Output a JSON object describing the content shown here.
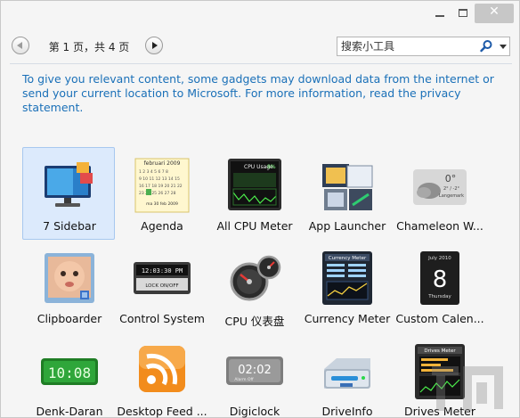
{
  "window": {
    "controls": {
      "minimize": "minimize",
      "maximize": "maximize",
      "close": "close"
    }
  },
  "pager": {
    "text": "第 1 页，共 4 页",
    "prev_icon": "chevron-left-icon",
    "next_icon": "chevron-right-icon"
  },
  "search": {
    "placeholder": "搜索小工具",
    "icon": "search-icon",
    "dropdown_icon": "chevron-down-icon"
  },
  "info": {
    "text": "To give you relevant content, some gadgets may download data from the internet or send your current location to Microsoft. For more information, read the privacy statement."
  },
  "gadgets": [
    {
      "label": "7 Sidebar",
      "icon": "monitor-icon",
      "selected": true
    },
    {
      "label": "Agenda",
      "icon": "calendar-icon",
      "calendar_header": "februari 2009",
      "calendar_footer": "ma 30 feb 2009"
    },
    {
      "label": "All CPU Meter",
      "icon": "cpu-meter-icon",
      "screen_title": "CPU Usage",
      "screen_value": "8%"
    },
    {
      "label": "App Launcher",
      "icon": "app-launcher-icon"
    },
    {
      "label": "Chameleon W...",
      "icon": "weather-cloud-icon",
      "temp": "0°",
      "range": "2° / -2°",
      "place": "Langemark"
    },
    {
      "label": "Clipboarder",
      "icon": "baby-photo-icon"
    },
    {
      "label": "Control System",
      "icon": "control-system-icon",
      "time": "12:03:30 PM",
      "status": "LOCK ON/OFF"
    },
    {
      "label": "CPU 仪表盘",
      "icon": "gauge-icon"
    },
    {
      "label": "Currency Meter",
      "icon": "currency-meter-icon",
      "screen_title": "Currency Meter"
    },
    {
      "label": "Custom Calen...",
      "icon": "custom-calendar-icon",
      "month": "July 2010",
      "day": "8",
      "weekday": "Thursday"
    },
    {
      "label": "Denk-Daran",
      "icon": "digital-clock-green-icon",
      "time": "10:08"
    },
    {
      "label": "Desktop Feed ...",
      "icon": "rss-feed-icon"
    },
    {
      "label": "Digiclock",
      "icon": "digiclock-icon",
      "time": "02:02",
      "sub": "Alarm Off"
    },
    {
      "label": "DriveInfo",
      "icon": "hard-drive-icon"
    },
    {
      "label": "Drives Meter",
      "icon": "drives-meter-icon",
      "screen_title": "Drives Meter"
    }
  ]
}
